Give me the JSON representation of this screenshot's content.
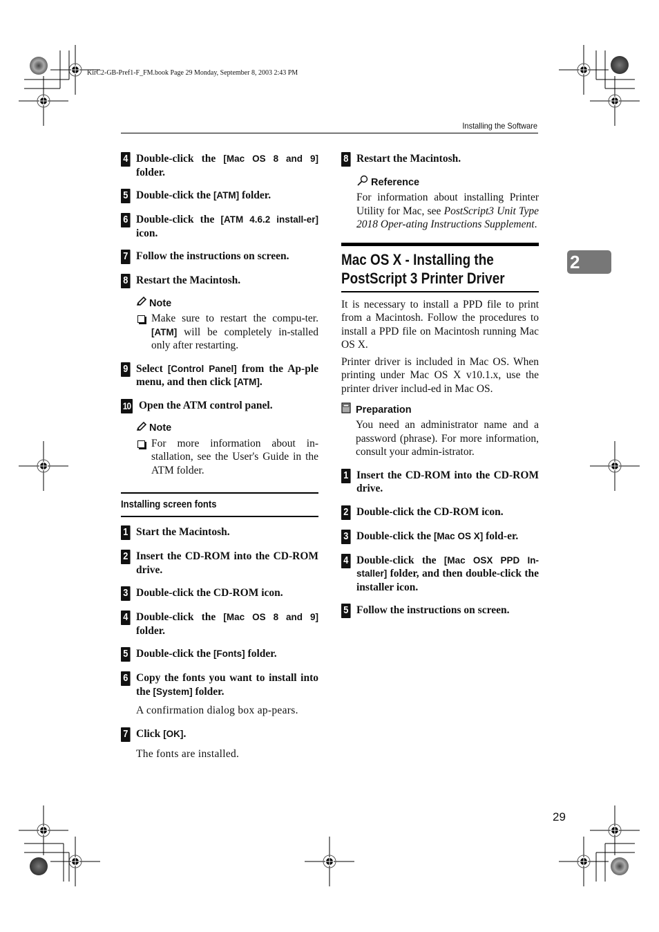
{
  "file_info": "KirC2-GB-Pref1-F_FM.book  Page 29  Monday, September 8, 2003  2:43 PM",
  "running_head": "Installing the Software",
  "chapter_tab": "2",
  "page_number": "29",
  "left_column": {
    "steps_a": [
      {
        "num": "4",
        "pre": "Double-click the ",
        "key": "[Mac OS 8 and 9]",
        "post": " folder."
      },
      {
        "num": "5",
        "pre": "Double-click the ",
        "key": "[ATM]",
        "post": " folder."
      },
      {
        "num": "6",
        "pre": "Double-click the ",
        "key": "[ATM 4.6.2 install-er]",
        "post": " icon."
      },
      {
        "num": "7",
        "pre": "Follow the instructions on screen.",
        "key": "",
        "post": ""
      },
      {
        "num": "8",
        "pre": "Restart the Macintosh.",
        "key": "",
        "post": ""
      }
    ],
    "note1": {
      "title": "Note",
      "pre": "Make sure to restart the compu-ter. ",
      "key": "[ATM]",
      "post": " will be completely in-stalled only after restarting."
    },
    "step9": {
      "num": "9",
      "pre": "Select ",
      "key": "[Control Panel]",
      "mid": " from the Ap-ple menu, and then click ",
      "key2": "[ATM]",
      "post": "."
    },
    "step10": {
      "num": "10",
      "text": "Open the ATM control panel."
    },
    "note2": {
      "title": "Note",
      "text": "For more information about in-stallation, see the User's Guide in the ATM folder."
    },
    "subsection_title": "Installing screen fonts",
    "steps_b": [
      {
        "num": "1",
        "pre": "Start the Macintosh.",
        "key": "",
        "post": ""
      },
      {
        "num": "2",
        "pre": "Insert the CD-ROM into the CD-ROM drive.",
        "key": "",
        "post": ""
      },
      {
        "num": "3",
        "pre": "Double-click the CD-ROM icon.",
        "key": "",
        "post": ""
      },
      {
        "num": "4",
        "pre": "Double-click the ",
        "key": "[Mac OS 8 and 9]",
        "post": " folder."
      },
      {
        "num": "5",
        "pre": "Double-click the ",
        "key": "[Fonts]",
        "post": " folder."
      },
      {
        "num": "6",
        "pre": "Copy the fonts you want to install into the ",
        "key": "[System]",
        "post": " folder."
      }
    ],
    "step6_result": "A confirmation dialog box ap-pears.",
    "step7": {
      "num": "7",
      "pre": "Click ",
      "key": "[OK]",
      "post": "."
    },
    "step7_result": "The fonts are installed."
  },
  "right_column": {
    "step8": {
      "num": "8",
      "text": "Restart the Macintosh."
    },
    "reference": {
      "title": "Reference",
      "pre": "For information about installing Printer Utility for Mac, see ",
      "italic": "PostScript3 Unit Type 2018 Oper-ating Instructions Supplement",
      "post": "."
    },
    "heading": {
      "line1": "Mac OS X - Installing the",
      "line2": "PostScript 3 Printer Driver"
    },
    "para1": "It is necessary to install a PPD file to print from a Macintosh. Follow the procedures to install a PPD file on Macintosh running Mac OS X.",
    "para2": "Printer driver is included in Mac OS. When printing under Mac OS X v10.1.x, use the printer driver includ-ed in Mac OS.",
    "preparation": {
      "title": "Preparation",
      "text": "You need an administrator name and a password (phrase). For more information, consult your admin-istrator."
    },
    "steps": [
      {
        "num": "1",
        "pre": "Insert the CD-ROM into the CD-ROM drive.",
        "key": "",
        "post": ""
      },
      {
        "num": "2",
        "pre": "Double-click the CD-ROM icon.",
        "key": "",
        "post": ""
      },
      {
        "num": "3",
        "pre": "Double-click the ",
        "key": "[Mac OS X]",
        "post": " fold-er."
      },
      {
        "num": "4",
        "pre": "Double-click the ",
        "key": "[Mac OSX PPD In-staller]",
        "post": " folder, and then double-click the installer icon."
      },
      {
        "num": "5",
        "pre": "Follow the instructions on screen.",
        "key": "",
        "post": ""
      }
    ]
  }
}
